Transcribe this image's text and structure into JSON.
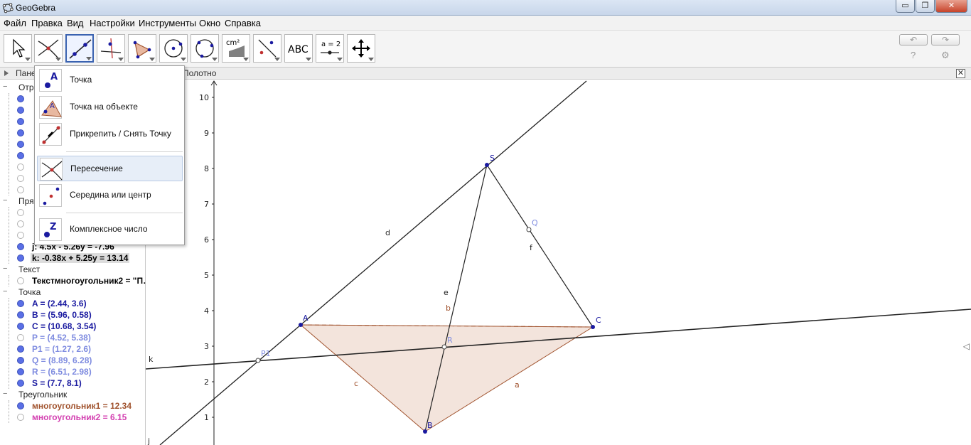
{
  "window": {
    "title": "GeoGebra",
    "minimize": "▭",
    "restore": "❐",
    "close": "✕"
  },
  "menu": [
    "Файл",
    "Правка",
    "Вид",
    "Настройки",
    "Инструменты",
    "Окно",
    "Справка"
  ],
  "toolbar": {
    "tools": [
      {
        "name": "move-tool"
      },
      {
        "name": "intersect-tool"
      },
      {
        "name": "line-tool",
        "selected": true
      },
      {
        "name": "perpendicular-tool"
      },
      {
        "name": "polygon-tool"
      },
      {
        "name": "circle-tool"
      },
      {
        "name": "circle-three-points-tool"
      },
      {
        "name": "area-tool",
        "label": "cm²"
      },
      {
        "name": "reflect-tool"
      },
      {
        "name": "text-tool",
        "label": "ABC"
      },
      {
        "name": "slider-tool",
        "label": "a = 2"
      },
      {
        "name": "move-graphics-tool"
      }
    ],
    "undo": "↶",
    "redo": "↷",
    "help": "?",
    "settings": "⚙"
  },
  "algebra_panel": {
    "header": "Панель объектов",
    "categories": {
      "segment": "Отрезок",
      "line": "Прямая",
      "text": "Текст",
      "point": "Точка",
      "triangle": "Треугольник"
    },
    "line_items": [
      {
        "text": "j: 4.5x - 5.26y = -7.96",
        "visible": true
      },
      {
        "text": "k: -0.38x + 5.25y = 13.14",
        "visible": true
      }
    ],
    "text_items": [
      {
        "text": "Текстмногоугольник2 = \"П…",
        "visible": false
      }
    ],
    "point_items": [
      {
        "text": "A = (2.44, 3.6)",
        "visible": true
      },
      {
        "text": "B = (5.96, 0.58)",
        "visible": true
      },
      {
        "text": "C = (10.68, 3.54)",
        "visible": true
      },
      {
        "text": "P = (4.52, 5.38)",
        "visible": false
      },
      {
        "text": "P1 = (1.27, 2.6)",
        "visible": true
      },
      {
        "text": "Q = (8.89, 6.28)",
        "visible": true
      },
      {
        "text": "R = (6.51, 2.98)",
        "visible": true
      },
      {
        "text": "S = (7.7, 8.1)",
        "visible": true
      }
    ],
    "triangle_items": [
      {
        "text": "многоугольник1 = 12.34",
        "visible": true
      },
      {
        "text": "многоугольник2 = 6.15",
        "visible": false
      }
    ]
  },
  "graphics_view": {
    "header": "Полотно",
    "y_ticks": [
      "1",
      "2",
      "3",
      "4",
      "5",
      "6",
      "7",
      "8",
      "9",
      "10"
    ],
    "point_labels": [
      "A",
      "B",
      "C",
      "S",
      "Q",
      "R",
      "P1"
    ],
    "object_labels": [
      "a",
      "b",
      "c",
      "d",
      "e",
      "f",
      "j",
      "k"
    ]
  },
  "dropdown": {
    "items": [
      {
        "label": "Точка",
        "icon": "point-icon"
      },
      {
        "label": "Точка на объекте",
        "icon": "point-on-object-icon"
      },
      {
        "label": "Прикрепить / Снять Точку",
        "icon": "attach-detach-point-icon"
      },
      {
        "label": "Пересечение",
        "icon": "intersection-icon",
        "highlighted": true
      },
      {
        "label": "Середина или центр",
        "icon": "midpoint-icon"
      },
      {
        "label": "Комплексное число",
        "icon": "complex-number-icon"
      }
    ]
  },
  "colors": {
    "point_blue": "#1a1aa0",
    "polygon_brown": "#a0522d",
    "polygon_fill": "#f3e4dc",
    "pink": "#d33fb0",
    "light_point": "#7f8ce0"
  }
}
